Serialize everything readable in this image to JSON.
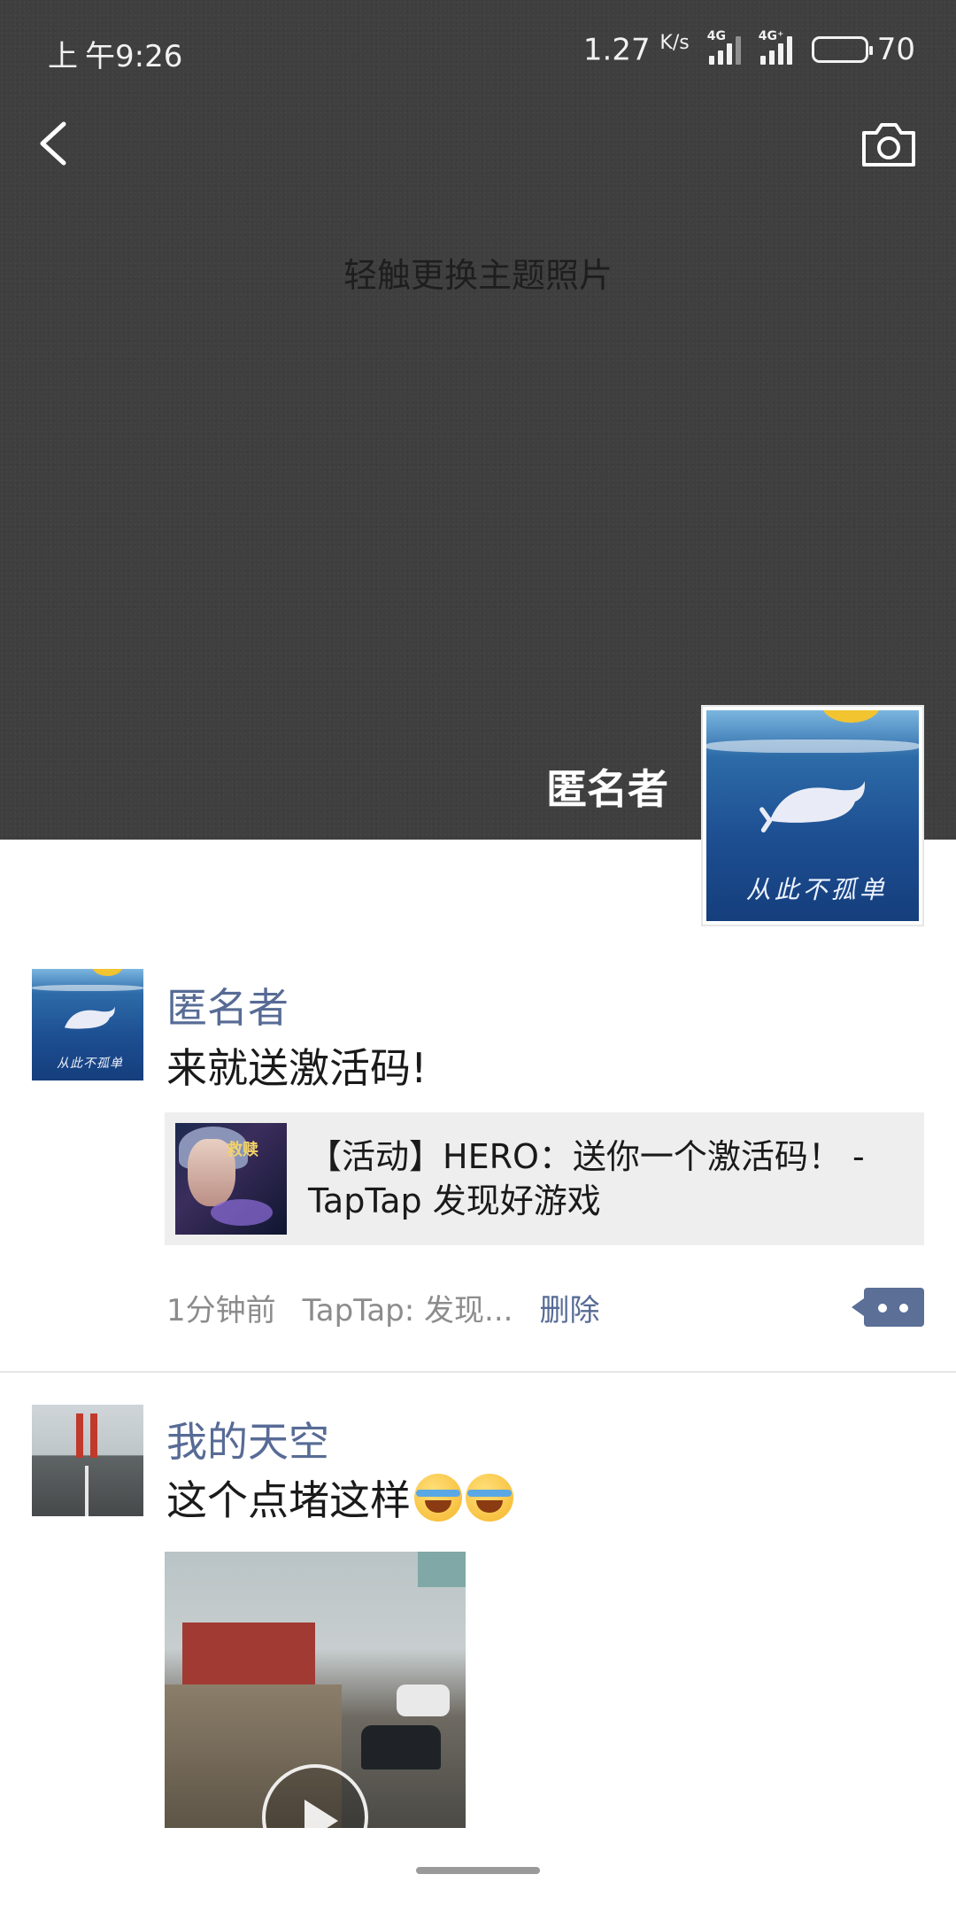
{
  "status_bar": {
    "carrier_icon": "上",
    "time": "午9:26",
    "net_speed": "1.27",
    "net_speed_unit": "K/s",
    "signal1_tag": "4G",
    "signal2_tag": "4G⁺",
    "battery": "70",
    "battery_level": 0.7
  },
  "cover": {
    "hint": "轻触更换主题照片",
    "profile_name": "匿名者"
  },
  "posts": [
    {
      "name": "匿名者",
      "text": "来就送激活码!",
      "link": {
        "thumb_title": "救赎",
        "title": "【活动】HERO：送你一个激活码！ - TapTap 发现好游戏"
      },
      "time": "1分钟前",
      "source": "TapTap: 发现...",
      "delete": "删除"
    },
    {
      "name": "我的天空",
      "text": "这个点堵这样"
    }
  ],
  "icons": [
    "back-icon",
    "camera-icon",
    "comment-icon",
    "play-icon",
    "laughing-crying-emoji-icon"
  ],
  "colors": {
    "cover_bg": "#3f3f3f",
    "link_blue": "#576b95",
    "card_bg": "#eeeeee"
  }
}
